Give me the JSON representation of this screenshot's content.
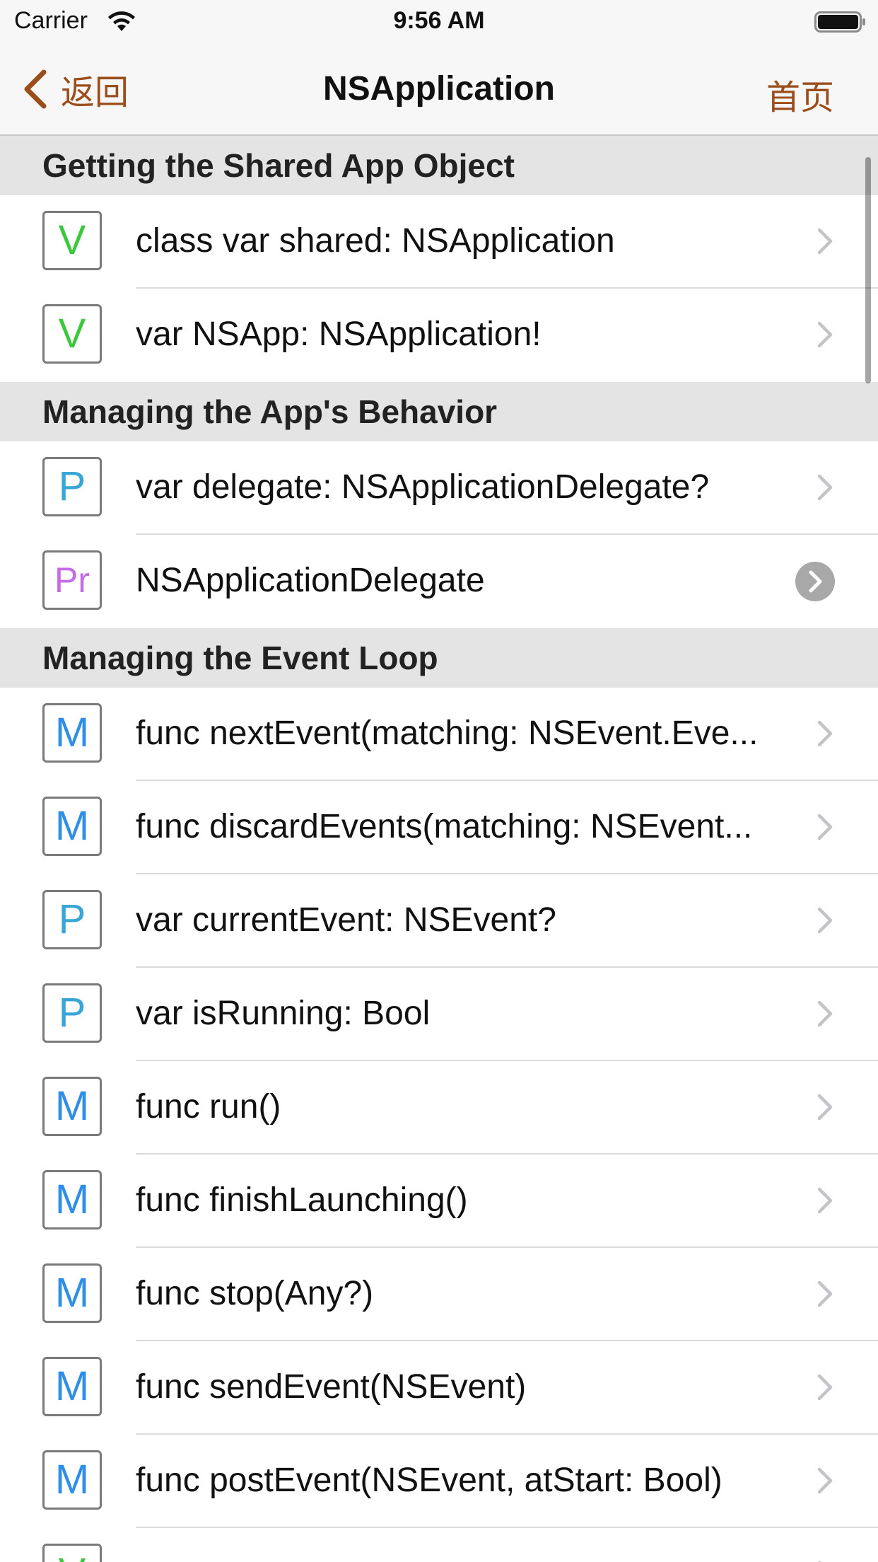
{
  "status_bar": {
    "carrier": "Carrier",
    "time": "9:56 AM",
    "wifi_icon": "wifi-icon",
    "battery_icon": "battery-full-icon"
  },
  "nav": {
    "back_label": "返回",
    "title": "NSApplication",
    "home_label": "首页",
    "accent_color": "#9a4e1c"
  },
  "badge_colors": {
    "V": "#3cc83c",
    "P": "#3aa6d8",
    "Pr": "#c46be6",
    "M": "#2f8fe8"
  },
  "sections": [
    {
      "header": "Getting the Shared App Object",
      "rows": [
        {
          "badge": "V",
          "title": "class var shared: NSApplication",
          "accessory": "chevron"
        },
        {
          "badge": "V",
          "title": "var NSApp: NSApplication!",
          "accessory": "chevron"
        }
      ]
    },
    {
      "header": "Managing the App's Behavior",
      "rows": [
        {
          "badge": "P",
          "title": "var delegate: NSApplicationDelegate?",
          "accessory": "chevron"
        },
        {
          "badge": "Pr",
          "title": "NSApplicationDelegate",
          "accessory": "chevron-circle"
        }
      ]
    },
    {
      "header": "Managing the Event Loop",
      "rows": [
        {
          "badge": "M",
          "title": "func nextEvent(matching: NSEvent.Eve...",
          "accessory": "chevron"
        },
        {
          "badge": "M",
          "title": "func discardEvents(matching: NSEvent...",
          "accessory": "chevron"
        },
        {
          "badge": "P",
          "title": "var currentEvent: NSEvent?",
          "accessory": "chevron"
        },
        {
          "badge": "P",
          "title": "var isRunning: Bool",
          "accessory": "chevron"
        },
        {
          "badge": "M",
          "title": "func run()",
          "accessory": "chevron"
        },
        {
          "badge": "M",
          "title": "func finishLaunching()",
          "accessory": "chevron"
        },
        {
          "badge": "M",
          "title": "func stop(Any?)",
          "accessory": "chevron"
        },
        {
          "badge": "M",
          "title": "func sendEvent(NSEvent)",
          "accessory": "chevron"
        },
        {
          "badge": "M",
          "title": "func postEvent(NSEvent, atStart: Bool)",
          "accessory": "chevron"
        },
        {
          "badge": "V",
          "title": "",
          "accessory": "chevron"
        }
      ]
    }
  ]
}
